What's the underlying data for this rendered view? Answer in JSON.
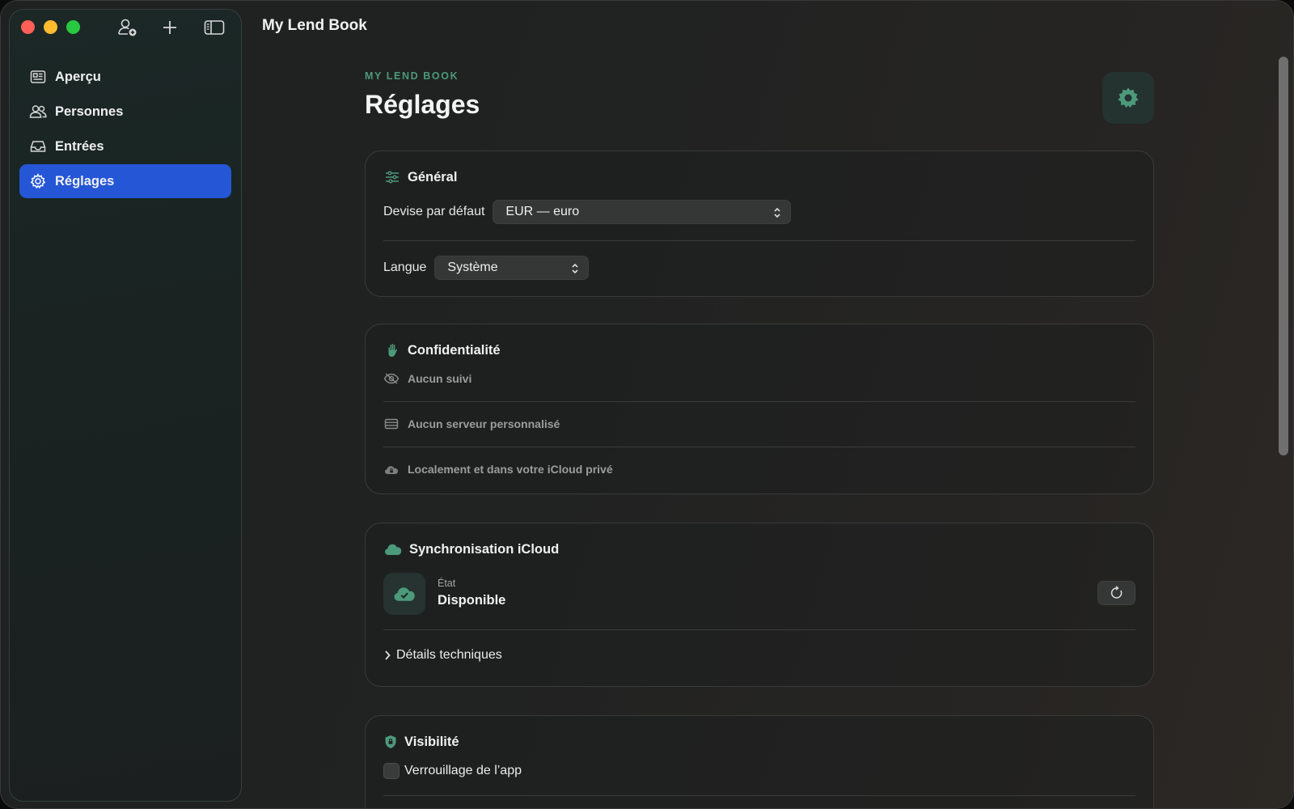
{
  "window": {
    "title": "My Lend Book"
  },
  "toolbar": {
    "icons": [
      "add-person-icon",
      "plus-icon",
      "sidebar-toggle-icon"
    ]
  },
  "sidebar": {
    "items": [
      {
        "label": "Aperçu",
        "icon": "newspaper-icon",
        "active": false
      },
      {
        "label": "Personnes",
        "icon": "people-icon",
        "active": false
      },
      {
        "label": "Entrées",
        "icon": "tray-icon",
        "active": false
      },
      {
        "label": "Réglages",
        "icon": "gear-icon",
        "active": true
      }
    ]
  },
  "header": {
    "eyebrow": "MY LEND BOOK",
    "title": "Réglages"
  },
  "general": {
    "title": "Général",
    "currency_label": "Devise par défaut",
    "currency_value": "EUR — euro",
    "language_label": "Langue",
    "language_value": "Système"
  },
  "privacy": {
    "title": "Confidentialité",
    "items": [
      {
        "label": "Aucun suivi",
        "icon": "eye-slash-icon"
      },
      {
        "label": "Aucun serveur personnalisé",
        "icon": "server-icon"
      },
      {
        "label": "Localement et dans votre iCloud privé",
        "icon": "lock-cloud-icon"
      }
    ]
  },
  "icloud": {
    "title": "Synchronisation iCloud",
    "status_label": "État",
    "status_value": "Disponible",
    "details_label": "Détails techniques"
  },
  "visibility": {
    "title": "Visibilité",
    "app_lock_label": "Verrouillage de l’app",
    "app_lock_checked": false
  },
  "colors": {
    "accent_green": "#4c9a7c",
    "selection_blue": "#2456d6"
  }
}
